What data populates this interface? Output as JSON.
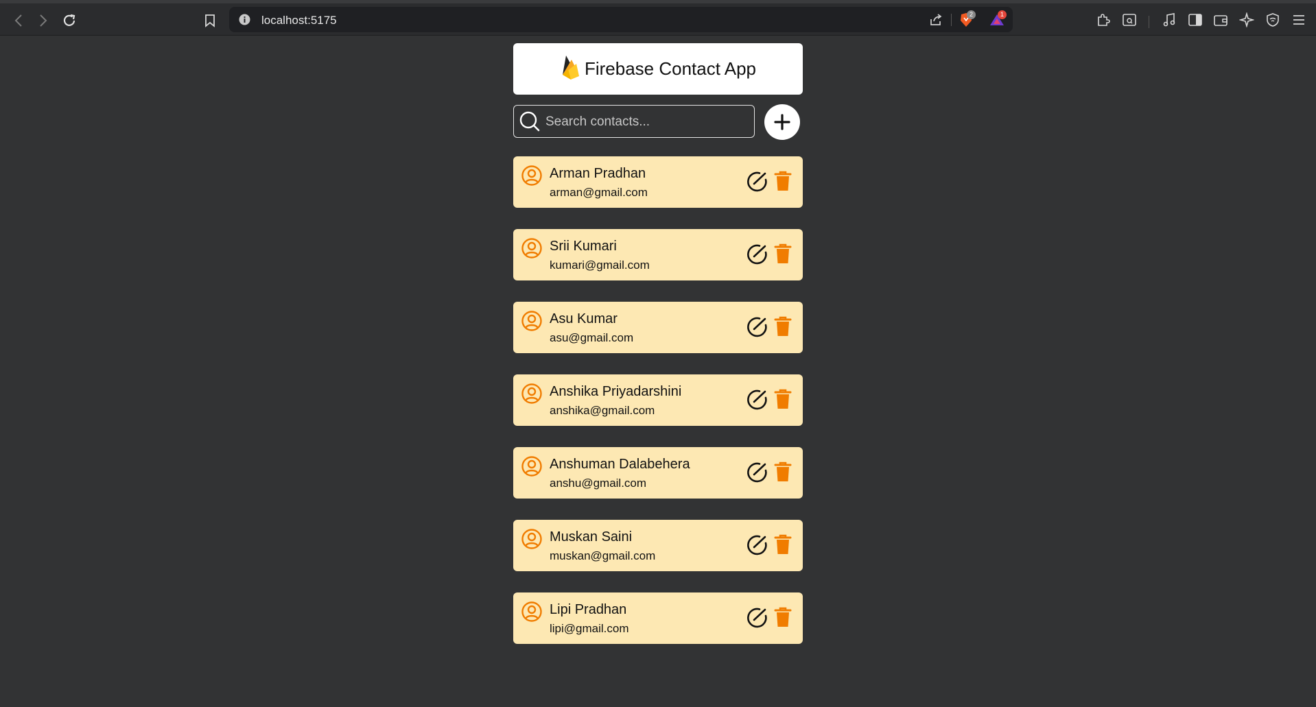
{
  "browser": {
    "url": "localhost:5175",
    "shield_badge": "2",
    "alert_badge": "1"
  },
  "app": {
    "title": "Firebase Contact App",
    "search_placeholder": "Search contacts...",
    "accent_color": "#f07c00",
    "card_color": "#fde8b3"
  },
  "contacts": [
    {
      "name": "Arman Pradhan",
      "email": "arman@gmail.com"
    },
    {
      "name": "Srii Kumari",
      "email": "kumari@gmail.com"
    },
    {
      "name": "Asu Kumar",
      "email": "asu@gmail.com"
    },
    {
      "name": "Anshika Priyadarshini",
      "email": "anshika@gmail.com"
    },
    {
      "name": "Anshuman Dalabehera",
      "email": "anshu@gmail.com"
    },
    {
      "name": "Muskan Saini",
      "email": "muskan@gmail.com"
    },
    {
      "name": "Lipi Pradhan",
      "email": "lipi@gmail.com"
    }
  ]
}
